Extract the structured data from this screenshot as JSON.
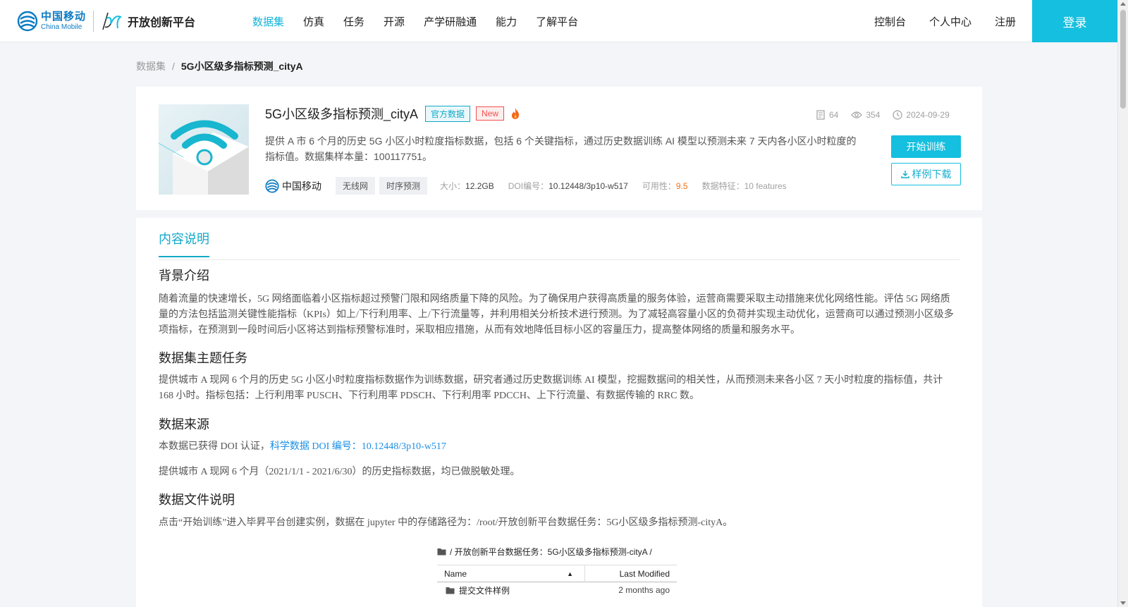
{
  "header": {
    "logo_cn": "中国移动",
    "logo_en": "China Mobile",
    "brand": "开放创新平台",
    "nav": [
      "数据集",
      "仿真",
      "任务",
      "开源",
      "产学研融通",
      "能力",
      "了解平台"
    ],
    "active_nav": "数据集",
    "right_nav": [
      "控制台",
      "个人中心",
      "注册"
    ],
    "login": "登录",
    "accent": "#15bfdf"
  },
  "breadcrumb": {
    "parent": "数据集",
    "sep": "/",
    "current": "5G小区级多指标预测_cityA"
  },
  "dataset": {
    "title": "5G小区级多指标预测_cityA",
    "tag_official": "官方数据",
    "tag_new": "New",
    "hot_icon": "fire-icon",
    "stats": {
      "files": "64",
      "views": "354",
      "date": "2024-09-29"
    },
    "description": "提供 A 市 6 个月的历史 5G 小区小时粒度指标数据，包括 6 个关键指标，通过历史数据训练 AI 模型以预测未来 7 天内各小区小时粒度的指标值。数据集样本量：100117751。",
    "provider": "中国移动",
    "tags": [
      "无线网",
      "时序预测"
    ],
    "size_label": "大小：",
    "size": "12.2GB",
    "doi_label": "DOI编号：",
    "doi": "10.12448/3p10-w517",
    "usability_label": "可用性：",
    "usability": "9.5",
    "features_label": "数据特征：",
    "features": "10 features",
    "btn_train": "开始训练",
    "btn_sample": "样例下载"
  },
  "content": {
    "tab": "内容说明",
    "sections": {
      "bg_title": "背景介绍",
      "bg_text": "随着流量的快速增长，5G 网络面临着小区指标超过预警门限和网络质量下降的风险。为了确保用户获得高质量的服务体验，运营商需要采取主动措施来优化网络性能。评估 5G 网络质量的方法包括监测关键性能指标（KPIs）如上/下行利用率、上/下行流量等，并利用相关分析技术进行预测。为了减轻高容量小区的负荷并实现主动优化，运营商可以通过预测小区级多项指标，在预测到一段时间后小区将达到指标预警标准时，采取相应措施，从而有效地降低目标小区的容量压力，提高整体网络的质量和服务水平。",
      "task_title": "数据集主题任务",
      "task_text": "提供城市 A 现网 6 个月的历史 5G 小区小时粒度指标数据作为训练数据，研究者通过历史数据训练 AI 模型，挖掘数据间的相关性，从而预测未来各小区 7 天小时粒度的指标值，共计 168 小时。指标包括：上行利用率 PUSCH、下行利用率 PDSCH、下行利用率 PDCCH、上下行流量、有数据传输的 RRC 数。",
      "src_title": "数据来源",
      "src_text_prefix": "本数据已获得 DOI 认证，",
      "src_link": "科学数据 DOI 编号：10.12448/3p10-w517",
      "src_text2": "提供城市 A 现网 6 个月（2021/1/1 - 2021/6/30）的历史指标数据，均已做脱敏处理。",
      "files_title": "数据文件说明",
      "files_text": "点击“开始训练”进入毕昇平台创建实例，数据在 jupyter 中的存储路径为：/root/开放创新平台数据任务：5G小区级多指标预测-cityA。"
    },
    "file_browser": {
      "path": "/ 开放创新平台数据任务：5G小区级多指标预测-cityA /",
      "col_name": "Name",
      "col_modified": "Last Modified",
      "rows": [
        {
          "name": "提交文件样例",
          "modified": "2 months ago"
        }
      ]
    }
  }
}
